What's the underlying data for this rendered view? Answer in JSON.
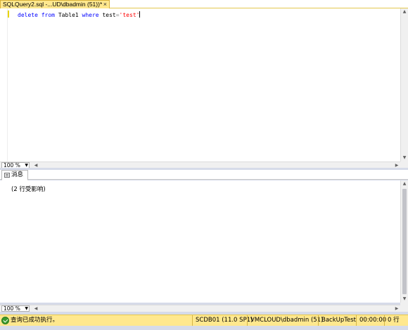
{
  "document_tab": {
    "title": "SQLQuery2.sql -...UD\\dbadmin (51))*",
    "close_glyph": "×"
  },
  "editor": {
    "tokens": [
      {
        "text": "delete",
        "kind": "keyword"
      },
      {
        "text": " ",
        "kind": "plain"
      },
      {
        "text": "from",
        "kind": "keyword"
      },
      {
        "text": " Table1 ",
        "kind": "plain"
      },
      {
        "text": "where",
        "kind": "keyword"
      },
      {
        "text": " test",
        "kind": "plain"
      },
      {
        "text": "=",
        "kind": "operator"
      },
      {
        "text": "'test'",
        "kind": "string"
      }
    ],
    "zoom": "100 %"
  },
  "results": {
    "tab_label": "消息",
    "message": "(2 行受影响)",
    "zoom": "100 %"
  },
  "status_bar": {
    "message": "查询已成功执行。",
    "server": "SCDB01 (11.0 SP1)",
    "user": "VMCLOUD\\dbadmin (51)",
    "database": "BackUpTest",
    "elapsed": "00:00:00",
    "rows": "0 行"
  },
  "colors": {
    "keyword": "#0000ff",
    "string": "#ff0000",
    "operator": "#808080",
    "tab_active": "#ffe88e",
    "status_bar": "#ffe88e",
    "success": "#3a9a2c"
  }
}
